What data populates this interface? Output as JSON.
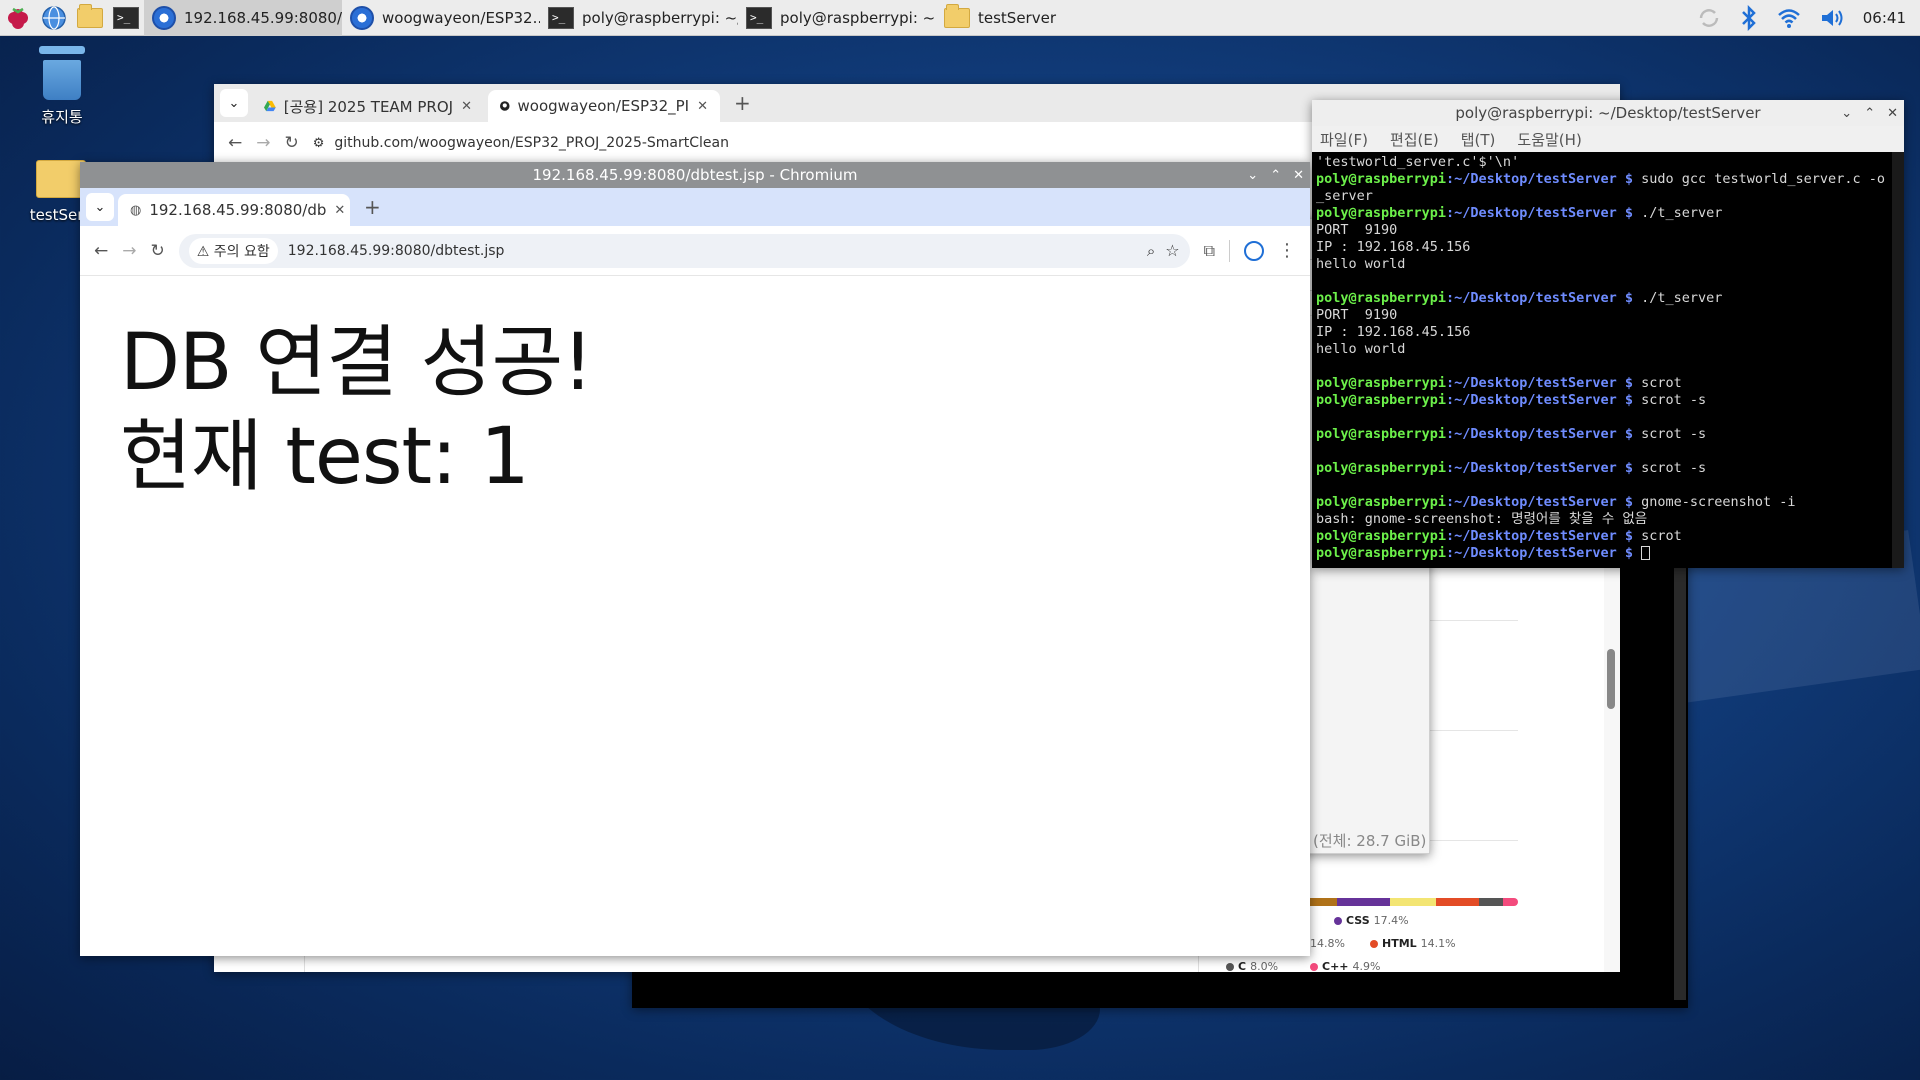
{
  "taskbar": {
    "items": [
      {
        "label": "192.168.45.99:8080/..",
        "icon": "chromium-icon",
        "active": true
      },
      {
        "label": "woogwayeon/ESP32..",
        "icon": "chromium-icon",
        "active": false
      },
      {
        "label": "poly@raspberrypi: ~/..",
        "icon": "terminal-icon",
        "active": false
      },
      {
        "label": "poly@raspberrypi: ~",
        "icon": "terminal-icon",
        "active": false
      },
      {
        "label": "testServer",
        "icon": "folder-icon",
        "active": false
      }
    ],
    "clock": "06:41"
  },
  "desktop": {
    "trash_label": "휴지통",
    "folder_label": "testServ"
  },
  "back_browser": {
    "tabs": [
      {
        "label": "[공용] 2025 TEAM PROJ"
      },
      {
        "label": "woogwayeon/ESP32_PI"
      }
    ],
    "url": "github.com/woogwayeon/ESP32_PROJ_2025-SmartClean",
    "languages": [
      {
        "name": "CSS",
        "pct": "17.4%",
        "color": "#663399"
      },
      {
        "name": "",
        "pct": "14.8%",
        "color": "#f1e05a"
      },
      {
        "name": "HTML",
        "pct": "14.1%",
        "color": "#e34c26"
      },
      {
        "name": "C",
        "pct": "8.0%",
        "color": "#555555"
      },
      {
        "name": "C++",
        "pct": "4.9%",
        "color": "#f34b7d"
      }
    ]
  },
  "file_manager": {
    "status": "(전체: 28.7 GiB)"
  },
  "front_browser": {
    "window_title": "192.168.45.99:8080/dbtest.jsp - Chromium",
    "tab_label": "192.168.45.99:8080/db",
    "security_chip": "주의 요함",
    "url": "192.168.45.99:8080/dbtest.jsp",
    "page": {
      "line1": "DB 연결 성공!",
      "line2": "현재 test: 1"
    }
  },
  "terminal": {
    "title": "poly@raspberrypi: ~/Desktop/testServer",
    "menu": [
      "파일(F)",
      "편집(E)",
      "탭(T)",
      "도움말(H)"
    ],
    "prompt_user": "poly@raspberrypi",
    "prompt_path": ":~/Desktop/testServer",
    "prompt_dollar": " $ ",
    "lines": [
      {
        "type": "out",
        "text": "'testworld_server.c'$'\\n'"
      },
      {
        "type": "cmd",
        "text": "sudo gcc testworld_server.c -o t"
      },
      {
        "type": "out",
        "text": "_server"
      },
      {
        "type": "cmd",
        "text": "./t_server"
      },
      {
        "type": "out",
        "text": "PORT  9190"
      },
      {
        "type": "out",
        "text": "IP : 192.168.45.156"
      },
      {
        "type": "out",
        "text": "hello world"
      },
      {
        "type": "out",
        "text": ""
      },
      {
        "type": "cmd",
        "text": "./t_server"
      },
      {
        "type": "out",
        "text": "PORT  9190"
      },
      {
        "type": "out",
        "text": "IP : 192.168.45.156"
      },
      {
        "type": "out",
        "text": "hello world"
      },
      {
        "type": "out",
        "text": ""
      },
      {
        "type": "cmd",
        "text": "scrot"
      },
      {
        "type": "cmd",
        "text": "scrot -s"
      },
      {
        "type": "out",
        "text": ""
      },
      {
        "type": "cmd",
        "text": "scrot -s"
      },
      {
        "type": "out",
        "text": ""
      },
      {
        "type": "cmd",
        "text": "scrot -s"
      },
      {
        "type": "out",
        "text": ""
      },
      {
        "type": "cmd",
        "text": "gnome-screenshot -i"
      },
      {
        "type": "out",
        "text": "bash: gnome-screenshot: 명령어를 찾을 수 없음"
      },
      {
        "type": "cmd",
        "text": "scrot"
      },
      {
        "type": "cur",
        "text": ""
      }
    ]
  }
}
